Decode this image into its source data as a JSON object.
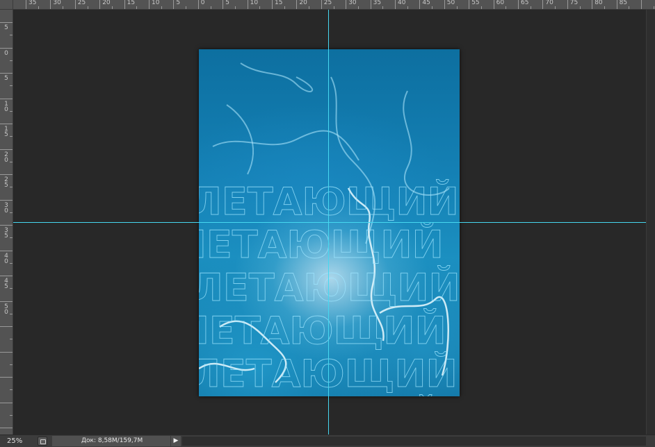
{
  "rulers": {
    "horizontal": [
      "35",
      "30",
      "25",
      "20",
      "15",
      "10",
      "5",
      "0",
      "5",
      "10",
      "15",
      "20",
      "25",
      "30",
      "35",
      "40",
      "45",
      "50",
      "55",
      "60",
      "65",
      "70",
      "75",
      "80",
      "85"
    ],
    "vertical": [
      "5",
      "0",
      "5",
      "10",
      "15",
      "20",
      "25",
      "30",
      "35",
      "40",
      "45",
      "50"
    ]
  },
  "artwork": {
    "text": "ЛЕТАЮЩИЙ",
    "colors": {
      "deep": "#0d6fa0",
      "mid": "#1b8fc0",
      "light": "#bfe8f5",
      "outline": "#9fe6ff",
      "guide": "#46d8f0"
    }
  },
  "statusbar": {
    "zoom": "25%",
    "doc_info": "Док: 8,58M/159,7M",
    "menu_arrow": "▶",
    "info_icon": "document-info-icon"
  }
}
